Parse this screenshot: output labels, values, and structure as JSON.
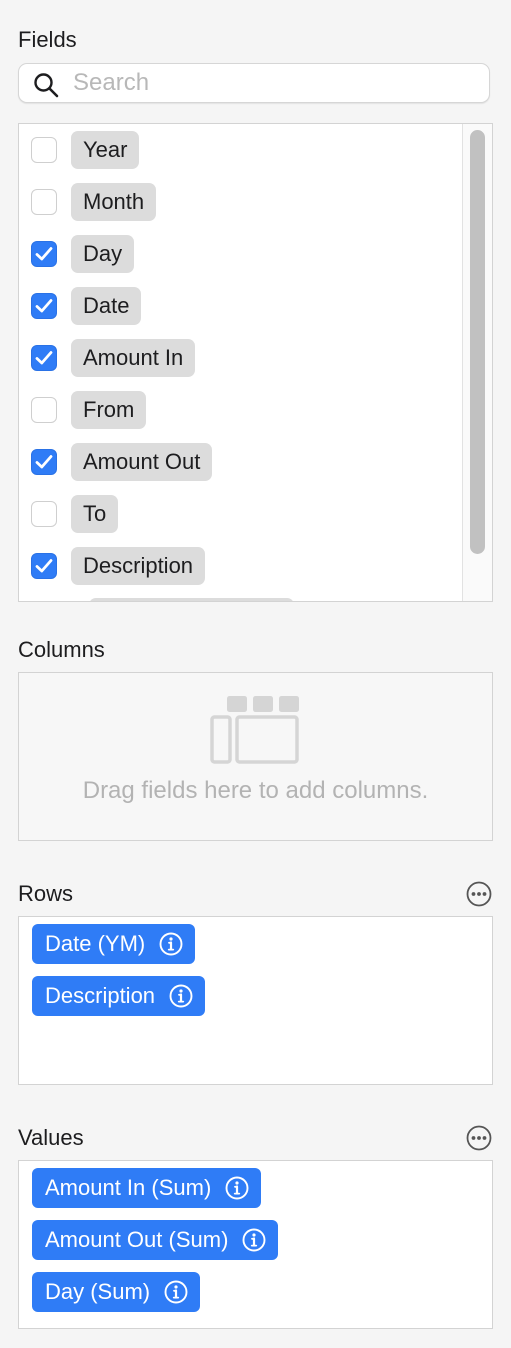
{
  "fields": {
    "title": "Fields",
    "search_placeholder": "Search",
    "items": [
      {
        "label": "Year",
        "checked": false
      },
      {
        "label": "Month",
        "checked": false
      },
      {
        "label": "Day",
        "checked": true
      },
      {
        "label": "Date",
        "checked": true
      },
      {
        "label": "Amount In",
        "checked": true
      },
      {
        "label": "From",
        "checked": false
      },
      {
        "label": "Amount Out",
        "checked": true
      },
      {
        "label": "To",
        "checked": false
      },
      {
        "label": "Description",
        "checked": true
      }
    ]
  },
  "columns": {
    "title": "Columns",
    "empty_text": "Drag fields here to add columns."
  },
  "rows": {
    "title": "Rows",
    "items": [
      {
        "label": "Date (YM)"
      },
      {
        "label": "Description"
      }
    ]
  },
  "values": {
    "title": "Values",
    "items": [
      {
        "label": "Amount In (Sum)"
      },
      {
        "label": "Amount Out (Sum)"
      },
      {
        "label": "Day (Sum)"
      }
    ]
  },
  "icons": {
    "search": "search-icon",
    "check": "checkmark-icon",
    "info": "info-icon",
    "more": "more-options-icon",
    "columns_placeholder": "column-layout-icon"
  },
  "colors": {
    "accent": "#2f7cf6",
    "chip": "#dcdcdc",
    "background": "#f5f5f5"
  }
}
